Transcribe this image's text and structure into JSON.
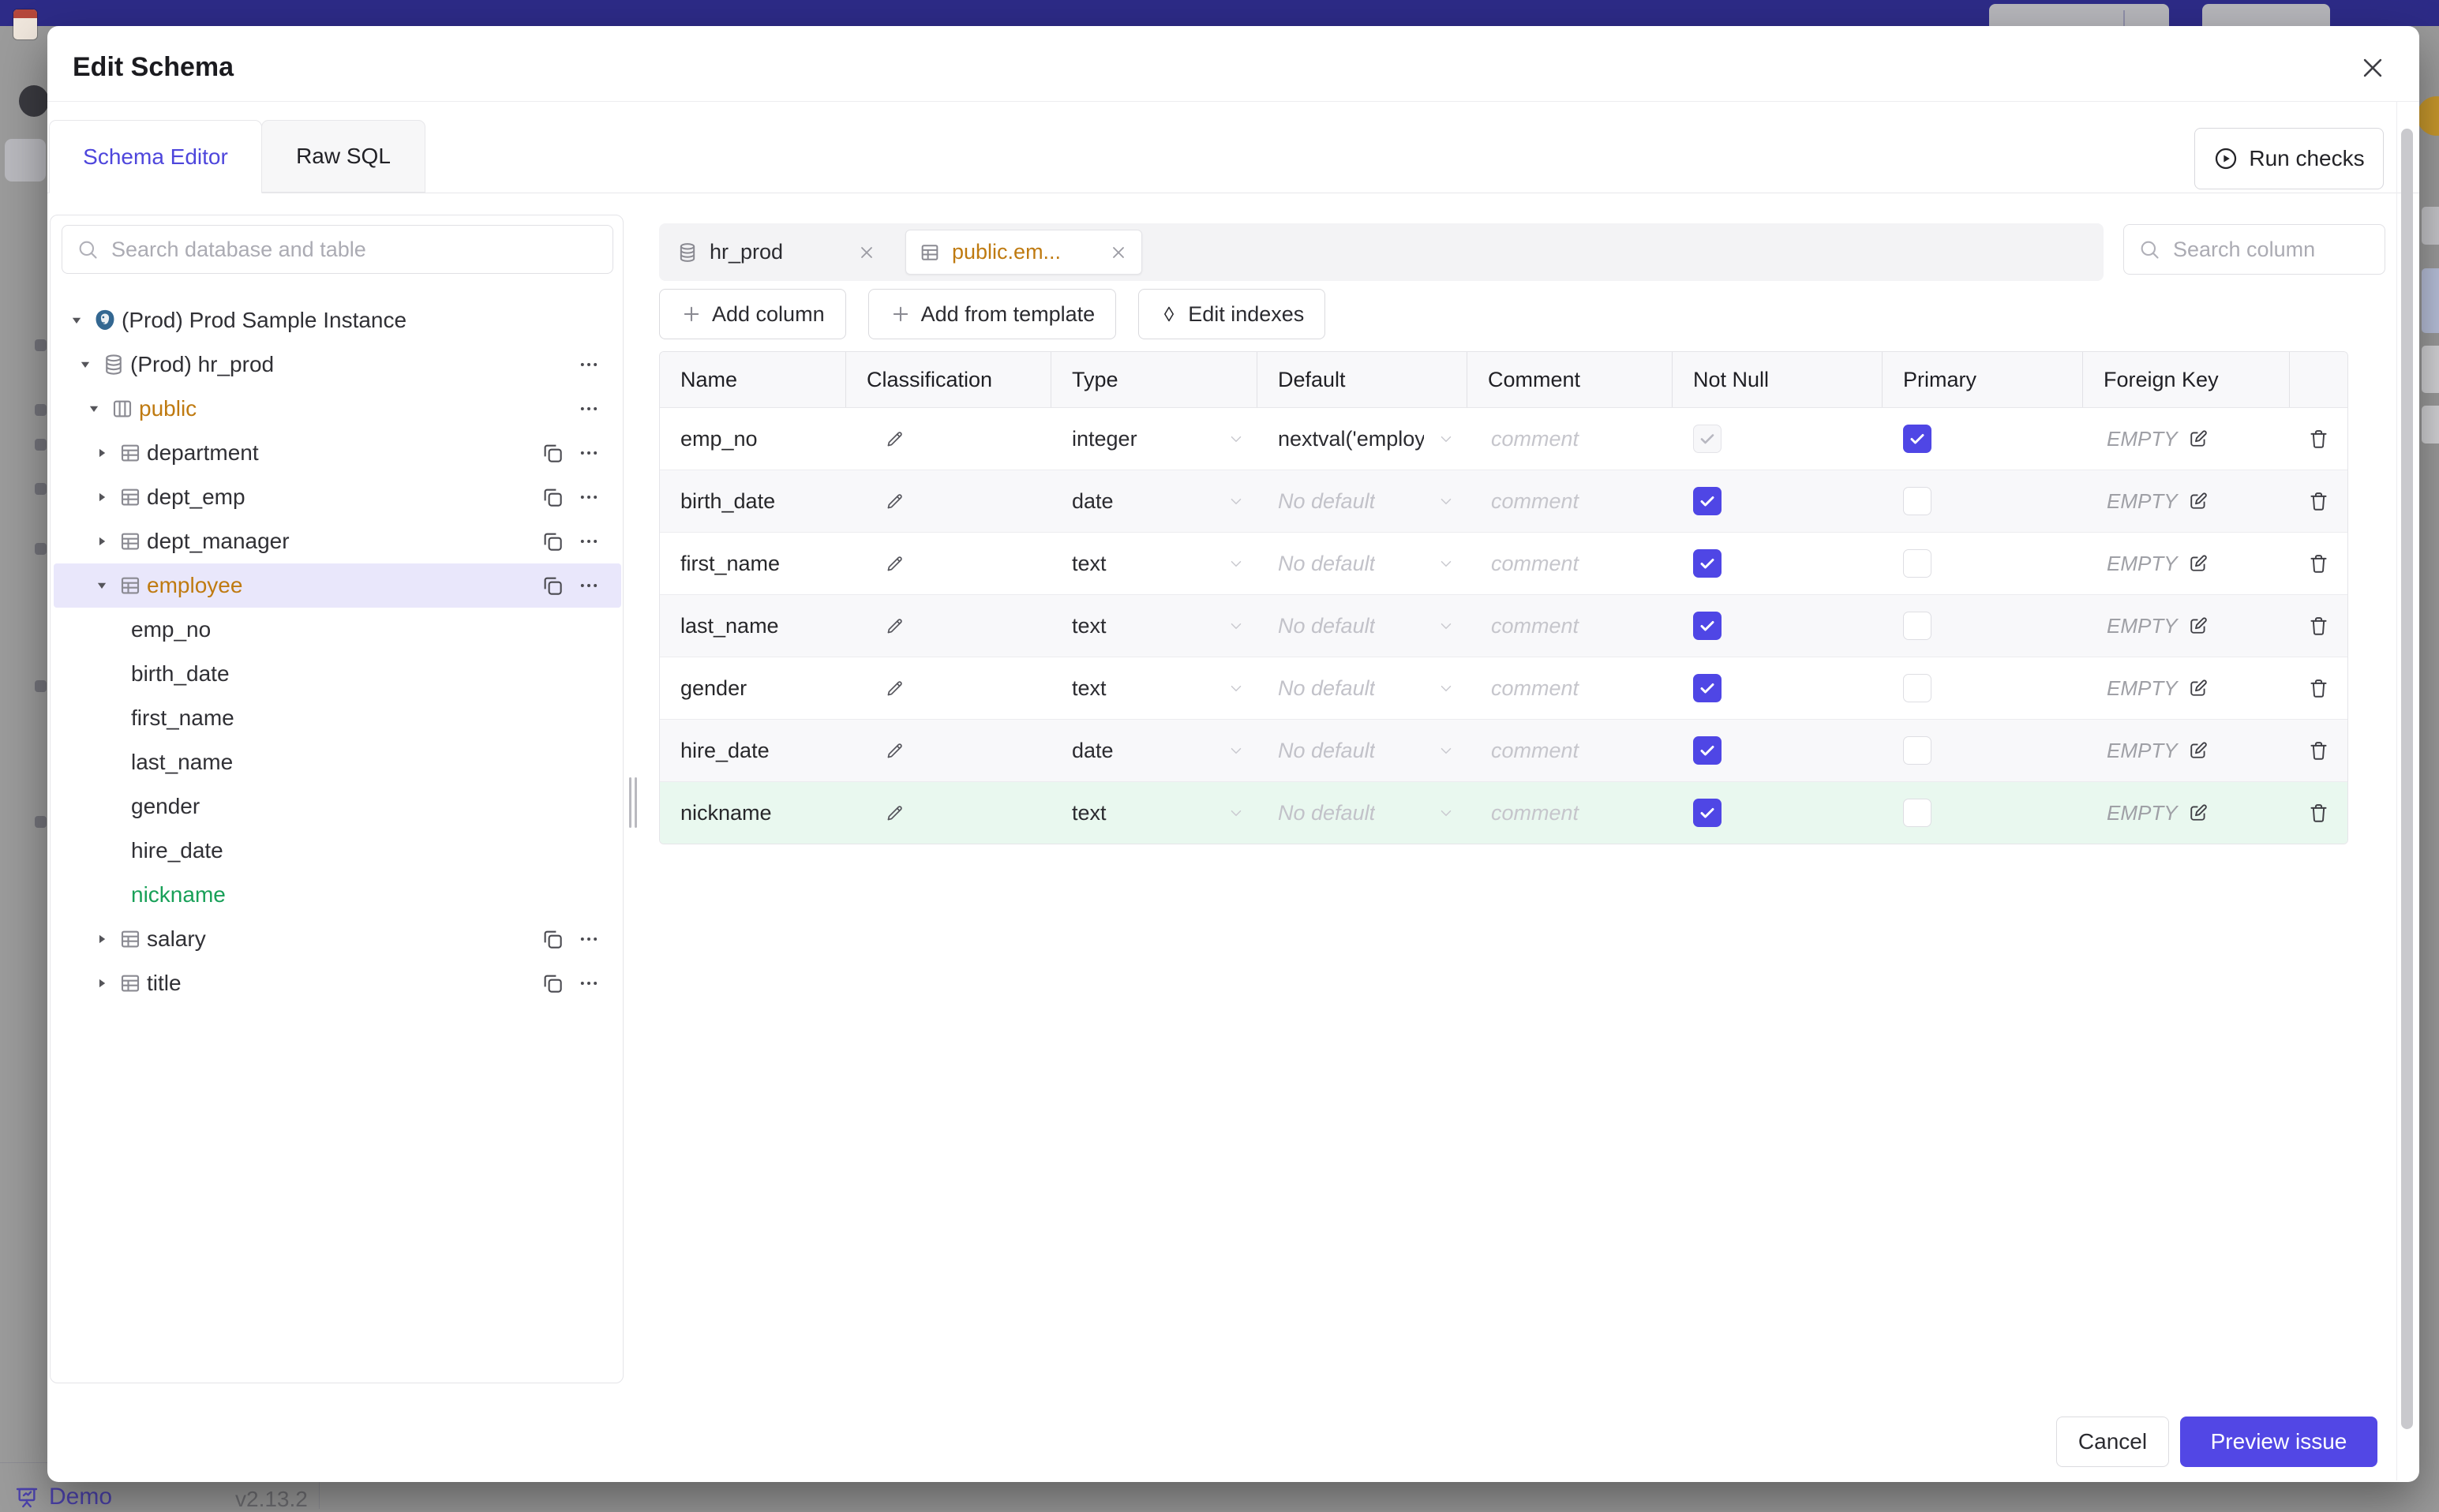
{
  "background": {
    "demo_label": "Demo",
    "version": "v2.13.2"
  },
  "modal": {
    "title": "Edit Schema",
    "tabs": {
      "schema_editor": "Schema Editor",
      "raw_sql": "Raw SQL"
    },
    "run_checks": "Run checks",
    "sidebar": {
      "search_placeholder": "Search database and table",
      "instance": "(Prod) Prod Sample Instance",
      "database": "(Prod) hr_prod",
      "schema": "public",
      "tables": [
        "department",
        "dept_emp",
        "dept_manager",
        "employee",
        "salary",
        "title"
      ],
      "selected_table": "employee",
      "columns": [
        "emp_no",
        "birth_date",
        "first_name",
        "last_name",
        "gender",
        "hire_date",
        "nickname"
      ],
      "new_column": "nickname"
    },
    "editor": {
      "tabs": [
        {
          "label": "hr_prod"
        },
        {
          "label": "public.em..."
        }
      ],
      "column_search_placeholder": "Search column",
      "toolbar": {
        "add_column": "Add column",
        "add_from_template": "Add from template",
        "edit_indexes": "Edit indexes"
      },
      "grid": {
        "headers": [
          "Name",
          "Classification",
          "Type",
          "Default",
          "Comment",
          "Not Null",
          "Primary",
          "Foreign Key"
        ],
        "comment_placeholder": "comment",
        "foreign_key_empty": "EMPTY",
        "no_default": "No default",
        "rows": [
          {
            "name": "emp_no",
            "type": "integer",
            "default": "nextval('employ",
            "has_default": true,
            "not_null": "checked-disabled",
            "primary": "checked",
            "state": "normal"
          },
          {
            "name": "birth_date",
            "type": "date",
            "default": "No default",
            "has_default": false,
            "not_null": "checked",
            "primary": "unchecked",
            "state": "normal"
          },
          {
            "name": "first_name",
            "type": "text",
            "default": "No default",
            "has_default": false,
            "not_null": "checked",
            "primary": "unchecked",
            "state": "normal"
          },
          {
            "name": "last_name",
            "type": "text",
            "default": "No default",
            "has_default": false,
            "not_null": "checked",
            "primary": "unchecked",
            "state": "normal"
          },
          {
            "name": "gender",
            "type": "text",
            "default": "No default",
            "has_default": false,
            "not_null": "checked",
            "primary": "unchecked",
            "state": "normal"
          },
          {
            "name": "hire_date",
            "type": "date",
            "default": "No default",
            "has_default": false,
            "not_null": "checked",
            "primary": "unchecked",
            "state": "normal"
          },
          {
            "name": "nickname",
            "type": "text",
            "default": "No default",
            "has_default": false,
            "not_null": "checked",
            "primary": "unchecked",
            "state": "new"
          }
        ]
      }
    },
    "footer": {
      "cancel": "Cancel",
      "preview_issue": "Preview issue"
    }
  },
  "colors": {
    "accent": "#4f46e5",
    "highlight_text": "#bf7a10",
    "new_item_text": "#18a058",
    "new_row_bg": "#e9f8ef"
  }
}
